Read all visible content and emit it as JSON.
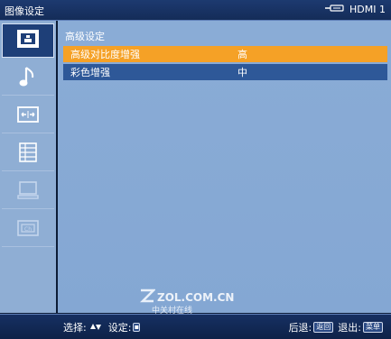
{
  "header": {
    "title": "图像设定",
    "source_label": "HDMI 1",
    "source_icon": "hdmi-connector-icon"
  },
  "sidebar": {
    "items": [
      {
        "name": "picture",
        "icon": "picture-icon",
        "active": true
      },
      {
        "name": "audio",
        "icon": "music-note-icon",
        "active": false
      },
      {
        "name": "screen",
        "icon": "aspect-ratio-icon",
        "active": false
      },
      {
        "name": "setup",
        "icon": "list-menu-icon",
        "active": false
      },
      {
        "name": "pc",
        "icon": "monitor-icon",
        "active": false
      },
      {
        "name": "channel",
        "icon": "channel-icon",
        "active": false
      }
    ]
  },
  "main": {
    "section_title": "高级设定",
    "rows": [
      {
        "label": "高级对比度增强",
        "value": "高",
        "selected": true
      },
      {
        "label": "彩色增强",
        "value": "中",
        "selected": false
      }
    ]
  },
  "footer": {
    "select_text": "选择:",
    "set_text": "设定:",
    "back_text": "后退:",
    "back_key": "返回",
    "exit_text": "退出:",
    "exit_key": "菜单"
  },
  "watermark": {
    "main": "ZOL.COM.CN",
    "sub": "中关村在线"
  },
  "colors": {
    "highlight": "#f5a126",
    "row_bg": "#2e5898",
    "content_bg": "#8aacd6",
    "bar_bg": "#142c58"
  }
}
